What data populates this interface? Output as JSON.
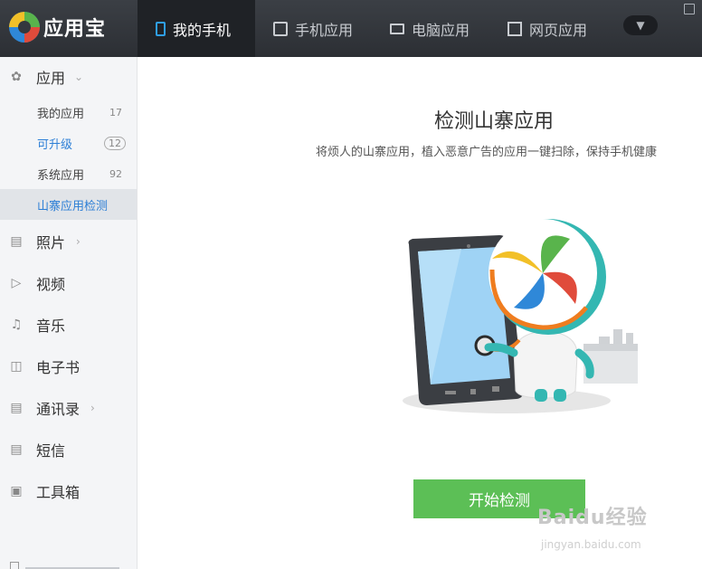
{
  "app": {
    "name": "应用宝"
  },
  "tabs": [
    {
      "label": "我的手机",
      "icon": "phone-icon",
      "active": true
    },
    {
      "label": "手机应用",
      "icon": "bag-icon",
      "active": false
    },
    {
      "label": "电脑应用",
      "icon": "monitor-icon",
      "active": false
    },
    {
      "label": "网页应用",
      "icon": "webpage-icon",
      "active": false
    }
  ],
  "sidebar": {
    "sections": [
      {
        "label": "应用",
        "icon": "apps-icon",
        "expanded": true
      },
      {
        "label": "照片",
        "icon": "photo-icon"
      },
      {
        "label": "视频",
        "icon": "video-icon"
      },
      {
        "label": "音乐",
        "icon": "music-icon"
      },
      {
        "label": "电子书",
        "icon": "ebook-icon"
      },
      {
        "label": "通讯录",
        "icon": "contacts-icon"
      },
      {
        "label": "短信",
        "icon": "sms-icon"
      },
      {
        "label": "工具箱",
        "icon": "toolbox-icon"
      }
    ],
    "sub_items": [
      {
        "label": "我的应用",
        "count": "17"
      },
      {
        "label": "可升级",
        "count": "12"
      },
      {
        "label": "系统应用",
        "count": "92"
      },
      {
        "label": "山寨应用检测",
        "count": ""
      }
    ]
  },
  "main": {
    "title": "检测山寨应用",
    "subtitle": "将烦人的山寨应用，植入恶意广告的应用一键扫除，保持手机健康",
    "start_button": "开始检测"
  },
  "watermark": {
    "brand": "Baidu经验",
    "url": "jingyan.baidu.com"
  },
  "colors": {
    "topbar": "#2f3237",
    "active_tab": "#1f2226",
    "sidebar_bg": "#f4f5f7",
    "accent_blue": "#2d7fd6",
    "button_green": "#5cbf56"
  }
}
